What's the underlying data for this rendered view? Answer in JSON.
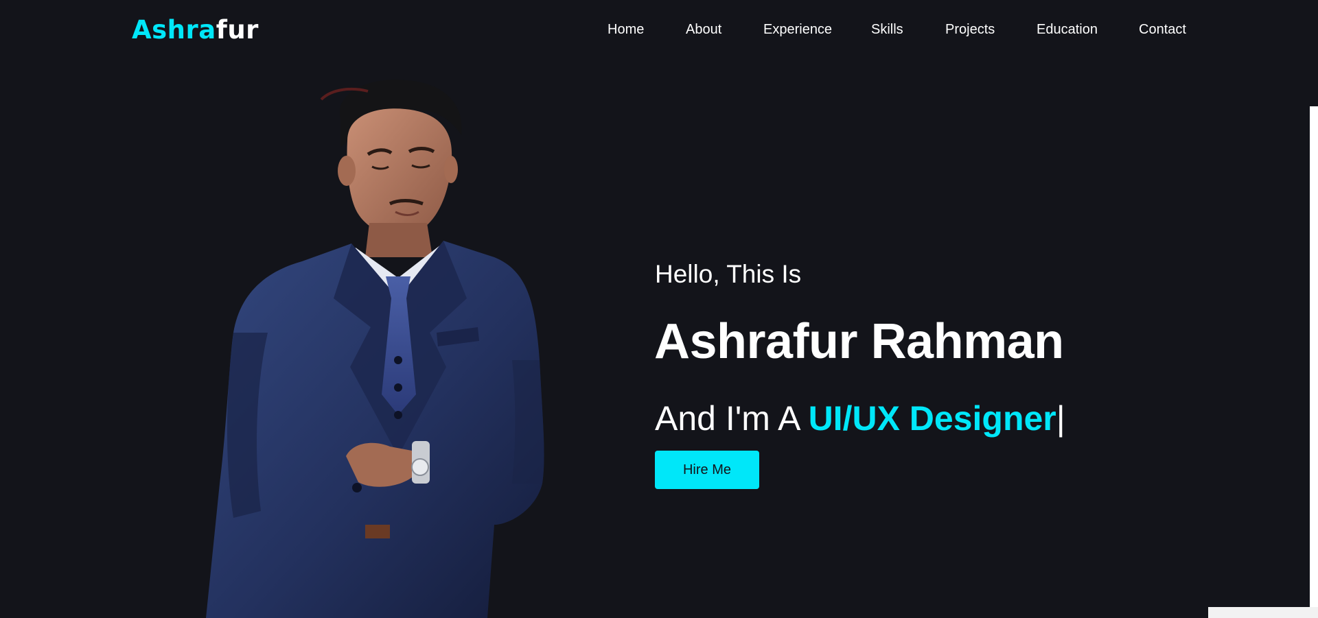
{
  "logo": {
    "accent": "Ashra",
    "rest": "fur"
  },
  "nav": {
    "items": [
      {
        "label": "Home"
      },
      {
        "label": "About"
      },
      {
        "label": "Experience"
      },
      {
        "label": "Skills"
      },
      {
        "label": "Projects"
      },
      {
        "label": "Education"
      },
      {
        "label": "Contact"
      }
    ]
  },
  "hero": {
    "greeting": "Hello, This Is",
    "name": "Ashrafur Rahman",
    "tagline_prefix": "And I'm A ",
    "role": "UI/UX Designer",
    "cursor": "|",
    "cta_label": "Hire Me"
  },
  "colors": {
    "background": "#13141a",
    "accent": "#00e7f9",
    "text": "#ffffff"
  }
}
